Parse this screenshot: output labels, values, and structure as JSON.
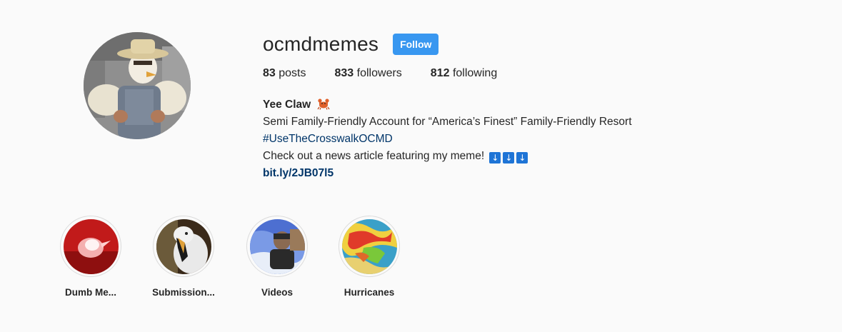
{
  "profile": {
    "username": "ocmdmemes",
    "follow_label": "Follow",
    "stats": {
      "posts_count": "83",
      "posts_label": "posts",
      "followers_count": "833",
      "followers_label": "followers",
      "following_count": "812",
      "following_label": "following"
    },
    "bio": {
      "name": "Yee Claw",
      "name_emoji": "crab-icon",
      "line1": "Semi Family-Friendly Account for “America’s Finest” Family-Friendly Resort",
      "hashtag": "#UseTheCrosswalkOCMD",
      "line3": "Check out a news article featuring my meme!",
      "arrows": [
        "↓",
        "↓",
        "↓"
      ],
      "link": "bit.ly/2JB07l5"
    }
  },
  "highlights": [
    {
      "label": "Dumb Me..."
    },
    {
      "label": "Submission..."
    },
    {
      "label": "Videos"
    },
    {
      "label": "Hurricanes"
    }
  ],
  "colors": {
    "background": "#fafafa",
    "follow_button": "#3897f0",
    "link": "#003569",
    "arrow_box": "#1e74d6"
  }
}
